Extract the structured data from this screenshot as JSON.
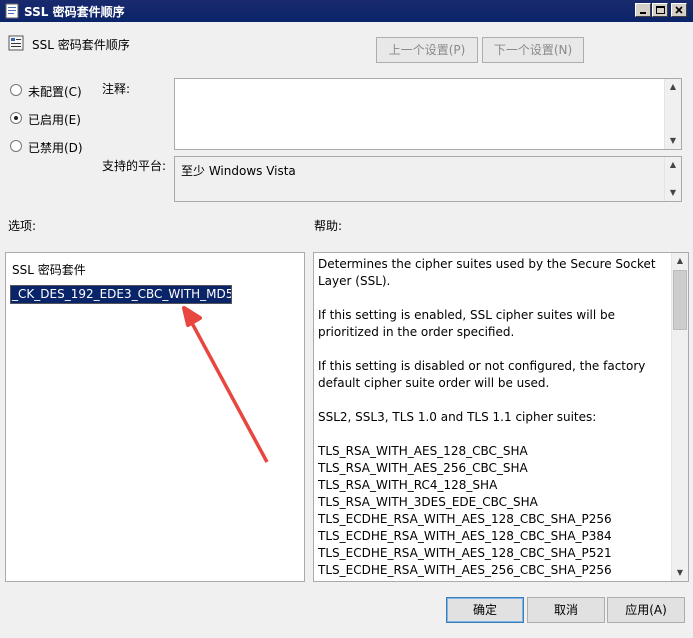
{
  "window": {
    "title": "SSL 密码套件顺序",
    "controls": [
      "minimize",
      "maximize",
      "close"
    ]
  },
  "header": {
    "policy_name": "SSL 密码套件顺序",
    "prev_label": "上一个设置(P)",
    "next_label": "下一个设置(N)"
  },
  "state": {
    "options": [
      {
        "label": "未配置(C)",
        "selected": false
      },
      {
        "label": "已启用(E)",
        "selected": true
      },
      {
        "label": "已禁用(D)",
        "selected": false
      }
    ]
  },
  "comment": {
    "label": "注释:",
    "value": ""
  },
  "platform": {
    "label": "支持的平台:",
    "value": "至少 Windows Vista"
  },
  "options_panel": {
    "label": "选项:",
    "field_label": "SSL 密码套件",
    "field_value": "_CK_DES_192_EDE3_CBC_WITH_MD5"
  },
  "help_panel": {
    "label": "帮助:",
    "paragraphs": [
      "Determines the cipher suites used by the Secure Socket Layer (SSL).",
      "If this setting is enabled, SSL cipher suites will be prioritized in the order specified.",
      "If this setting is disabled or not configured, the factory default cipher suite order will be used.",
      "SSL2, SSL3, TLS 1.0 and TLS 1.1 cipher suites:"
    ],
    "suites": [
      "TLS_RSA_WITH_AES_128_CBC_SHA",
      "TLS_RSA_WITH_AES_256_CBC_SHA",
      "TLS_RSA_WITH_RC4_128_SHA",
      "TLS_RSA_WITH_3DES_EDE_CBC_SHA",
      "TLS_ECDHE_RSA_WITH_AES_128_CBC_SHA_P256",
      "TLS_ECDHE_RSA_WITH_AES_128_CBC_SHA_P384",
      "TLS_ECDHE_RSA_WITH_AES_128_CBC_SHA_P521",
      "TLS_ECDHE_RSA_WITH_AES_256_CBC_SHA_P256"
    ]
  },
  "buttons": {
    "ok": "确定",
    "cancel": "取消",
    "apply": "应用(A)"
  },
  "colors": {
    "titlebar": "#0a246a",
    "selection": "#0a246a",
    "annotation_arrow": "#e8463f"
  }
}
